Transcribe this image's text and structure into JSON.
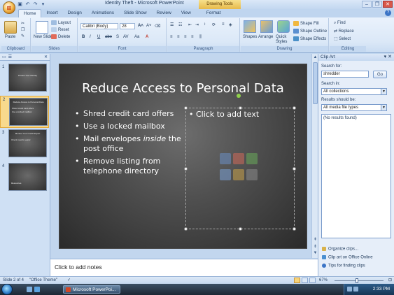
{
  "window": {
    "title": "Identity Theft - Microsoft PowerPoint",
    "contextual_tab_group": "Drawing Tools"
  },
  "ribbon": {
    "tabs": [
      "Home",
      "Insert",
      "Design",
      "Animations",
      "Slide Show",
      "Review",
      "View",
      "Format"
    ],
    "active_tab": "Home",
    "groups": {
      "clipboard": {
        "label": "Clipboard",
        "paste": "Paste"
      },
      "slides": {
        "label": "Slides",
        "new_slide": "New Slide",
        "layout": "Layout",
        "reset": "Reset",
        "delete": "Delete"
      },
      "font": {
        "label": "Font",
        "font_name": "Calibri (Body)",
        "font_size": "28",
        "bold": "B",
        "italic": "I",
        "underline": "U",
        "strike": "abe",
        "shadow": "S",
        "spacing": "AV",
        "case": "Aa",
        "color": "A"
      },
      "paragraph": {
        "label": "Paragraph"
      },
      "drawing": {
        "label": "Drawing",
        "shapes": "Shapes",
        "arrange": "Arrange",
        "quick_styles": "Quick Styles",
        "shape_fill": "Shape Fill",
        "shape_outline": "Shape Outline",
        "shape_effects": "Shape Effects"
      },
      "editing": {
        "label": "Editing",
        "find": "Find",
        "replace": "Replace",
        "select": "Select"
      }
    }
  },
  "slides_pane": {
    "tabs": [
      "Slides",
      "Outline"
    ],
    "thumbnails": [
      {
        "num": "1",
        "lines": [
          "Protect Your Identity"
        ]
      },
      {
        "num": "2",
        "lines": [
          "Reduce Access to Personal Data",
          "Shred credit card offers",
          "Use a locked mailbox"
        ]
      },
      {
        "num": "3",
        "lines": [
          "Monitor Your Credit Report",
          "Check reports yearly"
        ]
      },
      {
        "num": "4",
        "lines": [
          "Resources"
        ]
      }
    ],
    "selected_index": 2
  },
  "slide": {
    "title": "Reduce Access to Personal Data",
    "bullets": [
      "Shred credit card offers",
      "Use a locked mailbox",
      "Mail envelopes inside the post office",
      "Remove listing from telephone directory"
    ],
    "placeholder_text": "Click to add text"
  },
  "notes": {
    "placeholder": "Click to add notes"
  },
  "clip_art": {
    "title": "Clip Art",
    "search_for_label": "Search for:",
    "search_value": "shredder",
    "go_label": "Go",
    "search_in_label": "Search in:",
    "search_in_value": "All collections",
    "results_label": "Results should be:",
    "results_value": "All media file types",
    "no_results": "(No results found)",
    "links": [
      "Organize clips...",
      "Clip art on Office Online",
      "Tips for finding clips"
    ]
  },
  "statusbar": {
    "slide_info": "Slide 2 of 4",
    "theme": "\"Office Theme\"",
    "zoom": "67%"
  },
  "taskbar": {
    "task_label": "Microsoft PowerPoi...",
    "clock": "2:33 PM"
  }
}
